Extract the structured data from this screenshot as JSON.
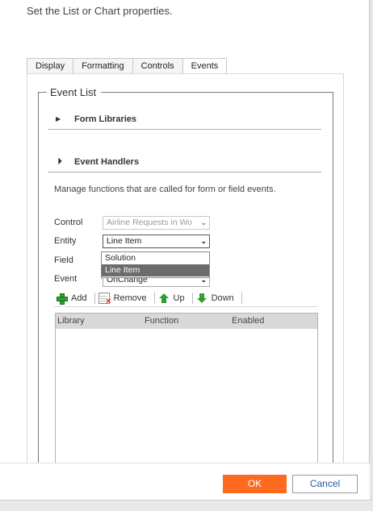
{
  "header": {
    "description": "Set the List or Chart properties."
  },
  "tabs": [
    {
      "label": "Display",
      "active": false
    },
    {
      "label": "Formatting",
      "active": false
    },
    {
      "label": "Controls",
      "active": false
    },
    {
      "label": "Events",
      "active": true
    }
  ],
  "event_list": {
    "legend": "Event List",
    "form_libraries": {
      "label": "Form Libraries",
      "expanded": false,
      "icon": "caret-right-icon"
    },
    "event_handlers": {
      "label": "Event Handlers",
      "expanded": true,
      "icon": "caret-down-icon",
      "description": "Manage functions that are called for form or field events."
    }
  },
  "form": {
    "control": {
      "label": "Control",
      "value": "Airline Requests in Wo",
      "disabled": true
    },
    "entity": {
      "label": "Entity",
      "value": "Line Item"
    },
    "field": {
      "label": "Field"
    },
    "event": {
      "label": "Event",
      "value": "OnChange"
    }
  },
  "entity_dropdown": {
    "options": [
      "Solution",
      "Line Item"
    ],
    "selected": "Line Item"
  },
  "toolbar": {
    "add_label": "Add",
    "remove_label": "Remove",
    "up_label": "Up",
    "down_label": "Down"
  },
  "handlers_table": {
    "columns": [
      "Library",
      "Function",
      "Enabled"
    ],
    "rows": []
  },
  "footer": {
    "ok_label": "OK",
    "cancel_label": "Cancel"
  },
  "colors": {
    "ok_button": "#ff6a21",
    "cancel_text": "#2b5d9b",
    "selected_option": "#6b6b6b"
  }
}
